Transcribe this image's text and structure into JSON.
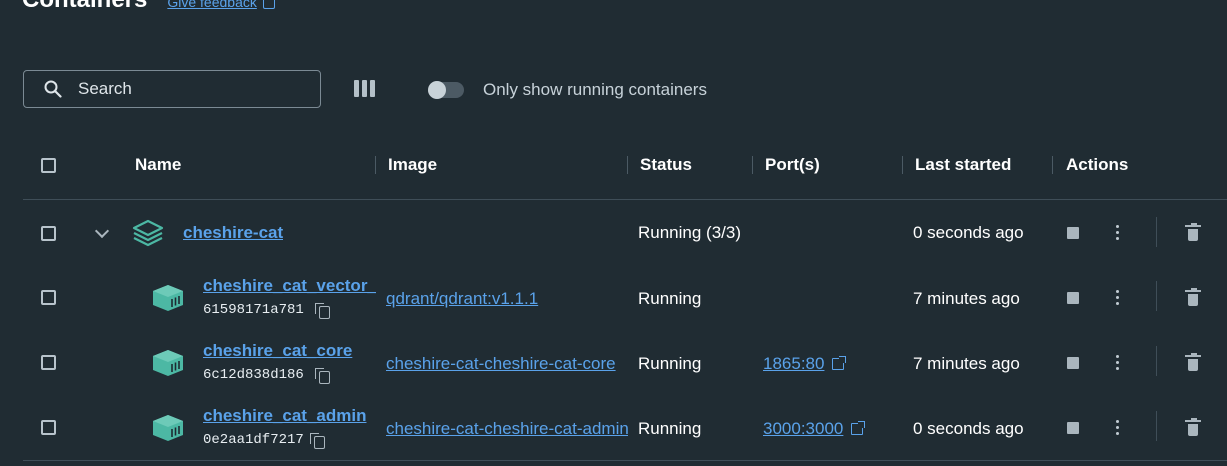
{
  "header": {
    "title": "Containers",
    "feedback_label": "Give feedback"
  },
  "toolbar": {
    "search_placeholder": "Search",
    "toggle_label": "Only show running containers",
    "toggle_on": false
  },
  "table": {
    "columns": {
      "name": "Name",
      "image": "Image",
      "status": "Status",
      "ports": "Port(s)",
      "last_started": "Last started",
      "actions": "Actions"
    },
    "group": {
      "name": "cheshire-cat",
      "status": "Running (3/3)",
      "last_started": "0 seconds ago"
    },
    "rows": [
      {
        "name": "cheshire_cat_vector_memory",
        "id": "61598171a781",
        "image": "qdrant/qdrant:v1.1.1",
        "status": "Running",
        "port": "",
        "last_started": "7 minutes ago"
      },
      {
        "name": "cheshire_cat_core",
        "id": "6c12d838d186",
        "image": "cheshire-cat-cheshire-cat-core",
        "status": "Running",
        "port": "1865:80",
        "last_started": "7 minutes ago"
      },
      {
        "name": "cheshire_cat_admin",
        "id": "0e2aa1df7217",
        "image": "cheshire-cat-cheshire-cat-admin",
        "status": "Running",
        "port": "3000:3000",
        "last_started": "0 seconds ago"
      }
    ]
  },
  "colors": {
    "background": "#202c33",
    "link": "#5aa2ea",
    "icon_teal": "#4cb8a4"
  }
}
